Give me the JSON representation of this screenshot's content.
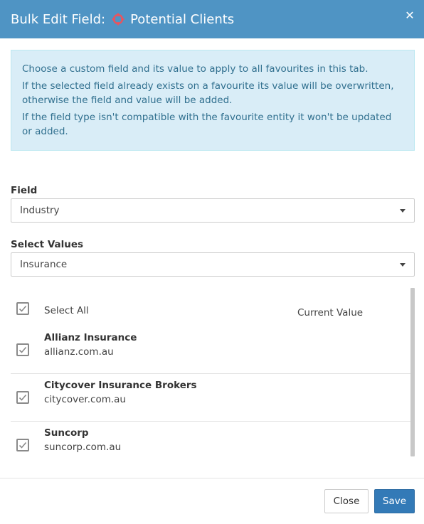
{
  "header": {
    "title": "Bulk Edit Field:",
    "favourite_name": "Potential Clients",
    "icon": "crosshair-icon",
    "accent_color": "#4f94c4"
  },
  "info": {
    "lines": [
      "Choose a custom field and its value to apply to all favourites in this tab.",
      "If the selected field already exists on a favourite its value will be overwritten, otherwise the field and value will be added.",
      "If the field type isn't compatible with the favourite entity it won't be updated or added."
    ]
  },
  "field": {
    "label": "Field",
    "value": "Industry"
  },
  "values": {
    "label": "Select Values",
    "value": "Insurance"
  },
  "list": {
    "select_all_label": "Select All",
    "current_value_header": "Current Value",
    "rows": [
      {
        "name": "Allianz Insurance",
        "domain": "allianz.com.au",
        "checked": true
      },
      {
        "name": "Citycover Insurance Brokers",
        "domain": "citycover.com.au",
        "checked": true
      },
      {
        "name": "Suncorp",
        "domain": "suncorp.com.au",
        "checked": true
      }
    ]
  },
  "footer": {
    "close_label": "Close",
    "save_label": "Save"
  }
}
